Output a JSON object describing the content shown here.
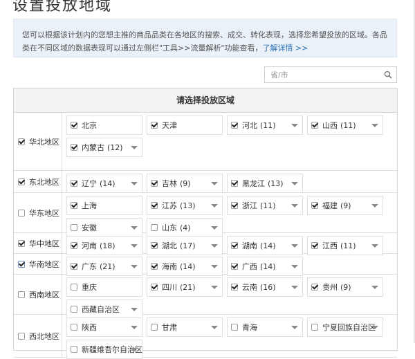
{
  "page_title": "设置投放地域",
  "notice": {
    "text": "您可以根据该计划内的您想主推的商品品类在各地区的搜索、成交、转化表现，选择您希望投放的区域。各品类在不同区域的数据表现可以通过左侧栏\"工具>>流量解析\"功能查看，",
    "link": "了解详情 >>"
  },
  "search": {
    "placeholder": "省/市"
  },
  "panel_title": "请选择投放区域",
  "colors": {
    "link": "#2a6fb5",
    "notice_bg": "#eaf1f8",
    "header_bg": "#f3f3f3"
  },
  "regions": [
    {
      "name": "华北地区",
      "checked": true,
      "height": 84,
      "provinces": [
        {
          "name": "北京",
          "count": "",
          "checked": true,
          "dropdown": false
        },
        {
          "name": "天津",
          "count": "",
          "checked": true,
          "dropdown": false
        },
        {
          "name": "河北",
          "count": "(11)",
          "checked": true,
          "dropdown": true
        },
        {
          "name": "山西",
          "count": "(11)",
          "checked": true,
          "dropdown": true
        },
        {
          "name": "内蒙古",
          "count": "(12)",
          "checked": true,
          "dropdown": true
        }
      ]
    },
    {
      "name": "东北地区",
      "checked": true,
      "height": 32,
      "provinces": [
        {
          "name": "辽宁",
          "count": "(14)",
          "checked": true,
          "dropdown": true
        },
        {
          "name": "吉林",
          "count": "(9)",
          "checked": true,
          "dropdown": true
        },
        {
          "name": "黑龙江",
          "count": "(13)",
          "checked": true,
          "dropdown": true
        }
      ]
    },
    {
      "name": "华东地区",
      "checked": false,
      "height": 58,
      "provinces": [
        {
          "name": "上海",
          "count": "",
          "checked": true,
          "dropdown": false
        },
        {
          "name": "江苏",
          "count": "(13)",
          "checked": true,
          "dropdown": true
        },
        {
          "name": "浙江",
          "count": "(11)",
          "checked": true,
          "dropdown": true
        },
        {
          "name": "福建",
          "count": "(9)",
          "checked": true,
          "dropdown": true
        },
        {
          "name": "安徽",
          "count": "",
          "checked": false,
          "dropdown": true
        },
        {
          "name": "山东",
          "count": "(4)",
          "checked": false,
          "dropdown": true
        }
      ]
    },
    {
      "name": "华中地区",
      "checked": true,
      "height": 30,
      "provinces": [
        {
          "name": "河南",
          "count": "(18)",
          "checked": true,
          "dropdown": true
        },
        {
          "name": "湖北",
          "count": "(17)",
          "checked": true,
          "dropdown": true
        },
        {
          "name": "湖南",
          "count": "(14)",
          "checked": true,
          "dropdown": true
        },
        {
          "name": "江西",
          "count": "(11)",
          "checked": true,
          "dropdown": true
        }
      ]
    },
    {
      "name": "华南地区",
      "checked": true,
      "height": 30,
      "blue": true,
      "provinces": [
        {
          "name": "广东",
          "count": "(21)",
          "checked": true,
          "dropdown": true
        },
        {
          "name": "海南",
          "count": "(14)",
          "checked": true,
          "dropdown": true
        },
        {
          "name": "广西",
          "count": "(14)",
          "checked": true,
          "dropdown": true
        }
      ]
    },
    {
      "name": "西南地区",
      "checked": false,
      "height": 58,
      "provinces": [
        {
          "name": "重庆",
          "count": "",
          "checked": false,
          "dropdown": false
        },
        {
          "name": "四川",
          "count": "(21)",
          "checked": true,
          "dropdown": true
        },
        {
          "name": "云南",
          "count": "(16)",
          "checked": true,
          "dropdown": true
        },
        {
          "name": "贵州",
          "count": "(9)",
          "checked": true,
          "dropdown": true
        },
        {
          "name": "西藏自治区",
          "count": "",
          "checked": false,
          "dropdown": true
        }
      ]
    },
    {
      "name": "西北地区",
      "checked": false,
      "height": 62,
      "provinces": [
        {
          "name": "陕西",
          "count": "",
          "checked": false,
          "dropdown": true
        },
        {
          "name": "甘肃",
          "count": "",
          "checked": false,
          "dropdown": true
        },
        {
          "name": "青海",
          "count": "",
          "checked": false,
          "dropdown": true
        },
        {
          "name": "宁夏回族自治区",
          "count": "",
          "checked": false,
          "dropdown": true
        },
        {
          "name": "新疆维吾尔自治区",
          "count": "",
          "checked": false,
          "dropdown": true
        }
      ]
    }
  ]
}
